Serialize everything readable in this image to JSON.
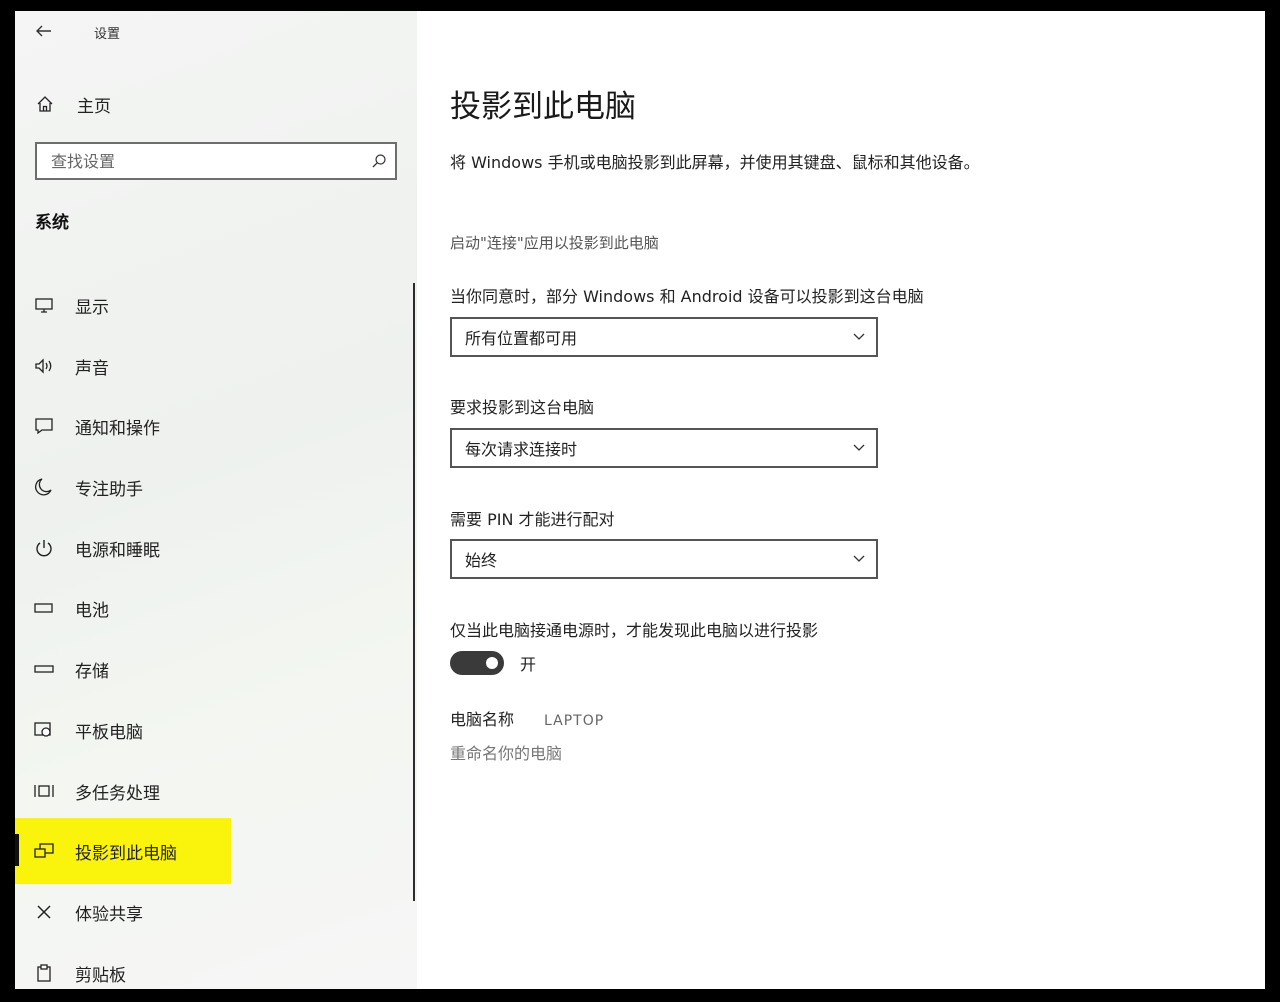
{
  "window": {
    "title": "设置"
  },
  "sidebar": {
    "home_label": "主页",
    "search_placeholder": "查找设置",
    "section": "系统",
    "items": [
      {
        "label": "显示",
        "icon": "monitor-icon"
      },
      {
        "label": "声音",
        "icon": "speaker-icon"
      },
      {
        "label": "通知和操作",
        "icon": "notification-icon"
      },
      {
        "label": "专注助手",
        "icon": "moon-icon"
      },
      {
        "label": "电源和睡眠",
        "icon": "power-icon"
      },
      {
        "label": "电池",
        "icon": "battery-icon"
      },
      {
        "label": "存储",
        "icon": "storage-icon"
      },
      {
        "label": "平板电脑",
        "icon": "tablet-icon"
      },
      {
        "label": "多任务处理",
        "icon": "multitask-icon"
      },
      {
        "label": "投影到此电脑",
        "icon": "project-icon",
        "active": true
      },
      {
        "label": "体验共享",
        "icon": "share-icon"
      },
      {
        "label": "剪贴板",
        "icon": "clipboard-icon"
      }
    ],
    "highlight_color": "#faf40c"
  },
  "main": {
    "title": "投影到此电脑",
    "description": "将 Windows 手机或电脑投影到此屏幕，并使用其键盘、鼠标和其他设备。",
    "connect_link": "启动\"连接\"应用以投影到此电脑",
    "fields": [
      {
        "label": "当你同意时，部分 Windows 和 Android 设备可以投影到这台电脑",
        "value": "所有位置都可用"
      },
      {
        "label": "要求投影到这台电脑",
        "value": "每次请求连接时"
      },
      {
        "label": "需要 PIN 才能进行配对",
        "value": "始终"
      }
    ],
    "power_label": "仅当此电脑接通电源时，才能发现此电脑以进行投影",
    "toggle_state": "开",
    "pc_name_label": "电脑名称",
    "pc_name_value": "LAPTOP",
    "rename_link": "重命名你的电脑"
  }
}
